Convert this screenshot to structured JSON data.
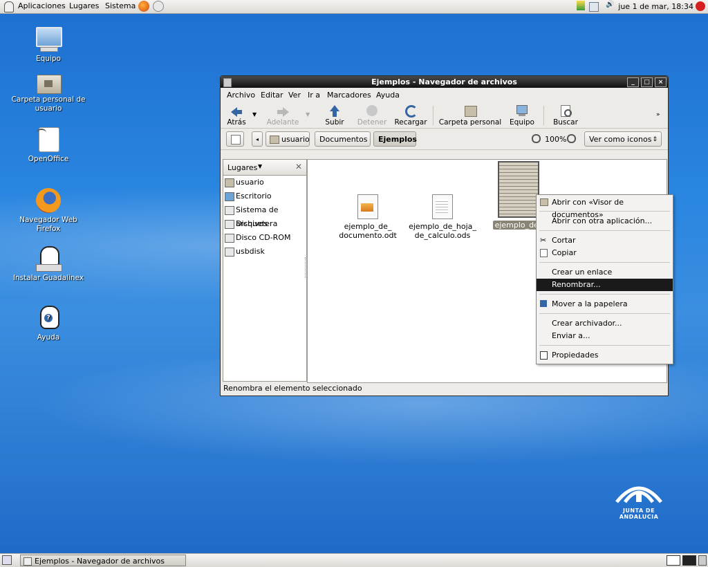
{
  "top_panel": {
    "menus": [
      "Aplicaciones",
      "Lugares",
      "Sistema"
    ],
    "clock": "jue  1 de mar, 18:34"
  },
  "desktop_icons": [
    {
      "label": "Equipo",
      "icon": "computer-icon"
    },
    {
      "label": "Carpeta personal de usuario",
      "icon": "home-folder-icon"
    },
    {
      "label": "OpenOffice",
      "icon": "openoffice-icon"
    },
    {
      "label": "Navegador Web Firefox",
      "icon": "firefox-icon"
    },
    {
      "label": "Instalar Guadalinex",
      "icon": "installer-icon"
    },
    {
      "label": "Ayuda",
      "icon": "help-icon"
    }
  ],
  "window": {
    "title": "Ejemplos - Navegador de archivos",
    "menubar": [
      "Archivo",
      "Editar",
      "Ver",
      "Ir a",
      "Marcadores",
      "Ayuda"
    ],
    "toolbar": {
      "back": "Atrás",
      "forward": "Adelante",
      "up": "Subir",
      "stop": "Detener",
      "reload": "Recargar",
      "home": "Carpeta personal",
      "computer": "Equipo",
      "search": "Buscar"
    },
    "path": [
      "usuario",
      "Documentos",
      "Ejemplos"
    ],
    "zoom": "100%",
    "view_mode": "Ver como iconos",
    "sidebar": {
      "header": "Lugares",
      "items": [
        "usuario",
        "Escritorio",
        "Sistema de archivos",
        "Disquetera",
        "Disco CD-ROM",
        "usbdisk"
      ]
    },
    "files": [
      {
        "name_line1": "ejemplo_de_",
        "name_line2": "documento.odt"
      },
      {
        "name_line1": "ejemplo_de_hoja_",
        "name_line2": "de_calculo.ods"
      },
      {
        "name_line1": "ejemplo_de_",
        "name_line2": ""
      }
    ],
    "status": "Renombra el elemento seleccionado"
  },
  "context_menu": {
    "items": [
      "Abrir con «Visor de documentos»",
      "Abrir con otra aplicación...",
      "Cortar",
      "Copiar",
      "Crear un enlace",
      "Renombrar...",
      "Mover a la papelera",
      "Crear archivador...",
      "Enviar a...",
      "Propiedades"
    ],
    "selected": "Renombrar..."
  },
  "taskbar": {
    "task": "Ejemplos - Navegador de archivos"
  },
  "logo_text": "JUNTA DE ANDALUCIA"
}
